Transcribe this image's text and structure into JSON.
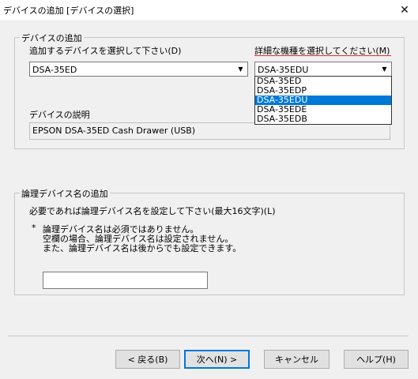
{
  "window": {
    "title": "デバイスの追加 [デバイスの選択]",
    "close": "✕"
  },
  "device_group": {
    "legend": "デバイスの追加",
    "device_label": "追加するデバイスを選択して下さい(D)",
    "device_value": "DSA-35ED",
    "model_label": "詳細な機種を選択してください(M)",
    "model_value": "DSA-35EDU",
    "model_options": [
      "DSA-35ED",
      "DSA-35EDP",
      "DSA-35EDU",
      "DSA-35EDE",
      "DSA-35EDB"
    ],
    "model_selected_index": 2,
    "description_label": "デバイスの説明",
    "description_value": "EPSON DSA-35ED Cash Drawer (USB)"
  },
  "logical_group": {
    "legend": "論理デバイス名の追加",
    "instruction": "必要であれば論理デバイス名を設定して下さい(最大16文字)(L)",
    "note_bullet": "*",
    "note_lines": [
      "論理デバイス名は必須ではありません。",
      "空欄の場合、論理デバイス名は設定されません。",
      "また、論理デバイス名は後からでも設定できます。"
    ],
    "name_value": ""
  },
  "buttons": {
    "back": "< 戻る(B)",
    "next": "次へ(N) >",
    "cancel": "キャンセル",
    "help": "ヘルプ(H)"
  },
  "colors": {
    "selection": "#0078d7",
    "accent_underline": "#e03030"
  },
  "icons": {
    "dropdown_arrow": "▼"
  }
}
